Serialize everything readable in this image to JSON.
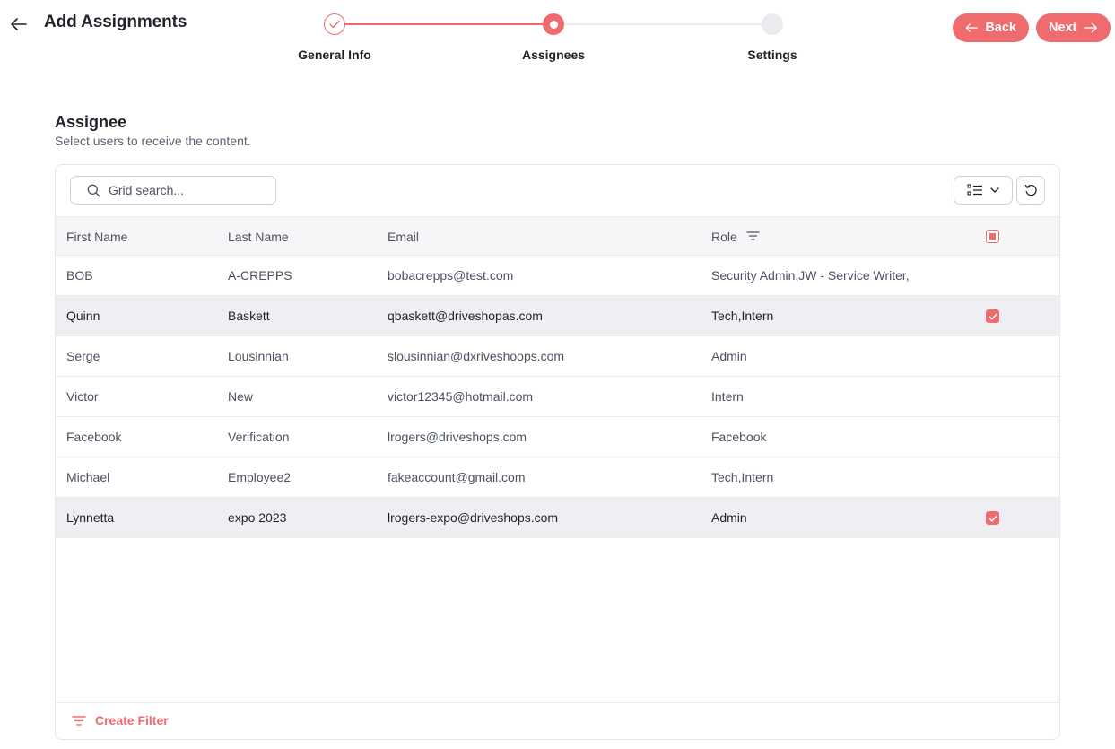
{
  "header": {
    "title": "Add Assignments",
    "back_label": "Back",
    "next_label": "Next"
  },
  "stepper": {
    "steps": [
      {
        "label": "General Info",
        "state": "complete"
      },
      {
        "label": "Assignees",
        "state": "active"
      },
      {
        "label": "Settings",
        "state": "pending"
      }
    ]
  },
  "section": {
    "title": "Assignee",
    "subtitle": "Select users to receive the content."
  },
  "grid": {
    "search_placeholder": "Grid search...",
    "columns": [
      "First Name",
      "Last Name",
      "Email",
      "Role"
    ],
    "rows": [
      {
        "first": "BOB",
        "last": "A-CREPPS",
        "email": "bobacrepps@test.com",
        "role": "Security Admin,JW - Service Writer,",
        "selected": false
      },
      {
        "first": "Quinn",
        "last": "Baskett",
        "email": "qbaskett@driveshopas.com",
        "role": "Tech,Intern",
        "selected": true
      },
      {
        "first": "Serge",
        "last": "Lousinnian",
        "email": "slousinnian@dxriveshoops.com",
        "role": "Admin",
        "selected": false
      },
      {
        "first": "Victor",
        "last": "New",
        "email": "victor12345@hotmail.com",
        "role": "Intern",
        "selected": false
      },
      {
        "first": "Facebook",
        "last": "Verification",
        "email": "lrogers@driveshops.com",
        "role": "Facebook",
        "selected": false
      },
      {
        "first": "Michael",
        "last": "Employee2",
        "email": "fakeaccount@gmail.com",
        "role": "Tech,Intern",
        "selected": false
      },
      {
        "first": "Lynnetta",
        "last": "expo 2023",
        "email": "lrogers-expo@driveshops.com",
        "role": "Admin",
        "selected": true
      }
    ],
    "create_filter_label": "Create Filter"
  },
  "colors": {
    "accent": "#ef6b6e",
    "selected_row": "#efeff3",
    "header_bg": "#f6f6f8"
  },
  "icons": {
    "back": "arrow-left-icon",
    "search": "search-icon",
    "columns": "column-list-icon",
    "reset": "reset-icon",
    "filter": "filter-icon",
    "check": "checkmark-icon"
  }
}
